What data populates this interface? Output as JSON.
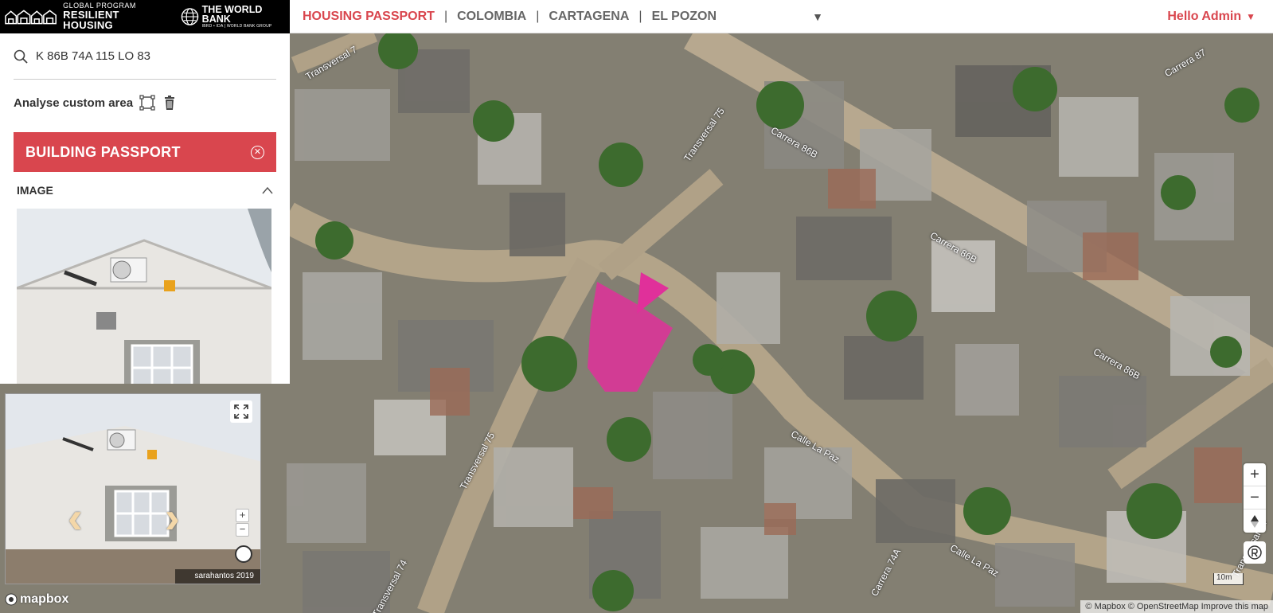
{
  "header": {
    "logo_small": "GLOBAL PROGRAM",
    "logo_big": "RESILIENT HOUSING",
    "wb_title": "THE WORLD BANK",
    "wb_sub": "IBRD • IDA | WORLD BANK GROUP",
    "breadcrumb": [
      "HOUSING PASSPORT",
      "COLOMBIA",
      "CARTAGENA",
      "EL POZON"
    ],
    "separator": "|",
    "user_greeting": "Hello Admin"
  },
  "sidebar": {
    "search_value": "K 86B 74A 115 LO 83",
    "custom_area_label": "Analyse custom area",
    "passport_title": "BUILDING PASSPORT",
    "image_section_title": "IMAGE"
  },
  "viewer": {
    "credit": "sarahantos 2019"
  },
  "map": {
    "street_labels": [
      "Transversal 7",
      "Transversal 75",
      "Carrera 86B",
      "Carrera 87",
      "Carrera 86B",
      "Carrera 86B",
      "Transversal 75",
      "Calle La Paz",
      "Calle La Paz",
      "Transversal 74",
      "Carrera 74A",
      "Transversal 74"
    ],
    "scale": "10m",
    "mapbox_text": "mapbox",
    "attribution": "© Mapbox © OpenStreetMap Improve this map",
    "highlight_color": "#e0309a"
  },
  "colors": {
    "accent": "#d9464e",
    "header_bg": "#000000"
  }
}
